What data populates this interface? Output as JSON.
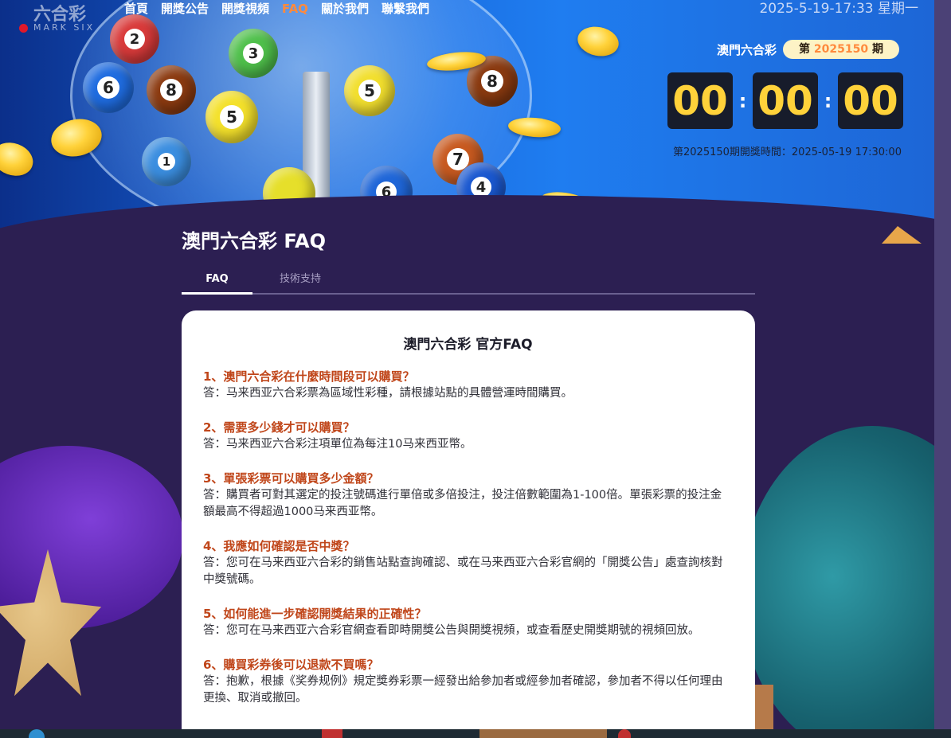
{
  "logo": {
    "main": "六合彩",
    "sub": "MARK SIX"
  },
  "nav": [
    {
      "label": "首頁"
    },
    {
      "label": "開獎公告"
    },
    {
      "label": "開獎視頻"
    },
    {
      "label": "FAQ"
    },
    {
      "label": "關於我們"
    },
    {
      "label": "聯繫我們"
    }
  ],
  "header": {
    "datetime": "2025-5-19-17:33 星期一",
    "lottery_name": "澳門六合彩",
    "draw_prefix": "第",
    "draw_number": "2025150",
    "draw_suffix": "期",
    "countdown": {
      "hours": "00",
      "minutes": "00",
      "seconds": "00",
      "separator": ":"
    },
    "draw_time": "第2025150期開獎時間：2025-05-19 17:30:00"
  },
  "balls": [
    "2",
    "3",
    "6",
    "8",
    "5",
    "5",
    "8",
    "7",
    "4",
    "1",
    "6"
  ],
  "page": {
    "title": "澳門六合彩 FAQ",
    "tabs": [
      {
        "label": "FAQ"
      },
      {
        "label": "技術支持"
      }
    ]
  },
  "faq": {
    "title": "澳門六合彩 官方FAQ",
    "items": [
      {
        "q": "1、澳門六合彩在什麼時間段可以購買？",
        "a": "答：马来西亚六合彩票為區域性彩種，請根據站點的具體營運時間購買。"
      },
      {
        "q": "2、需要多少錢才可以購買？",
        "a": "答：马来西亚六合彩注項單位為每注10马来西亚幣。"
      },
      {
        "q": "3、單張彩票可以購買多少金額？",
        "a": "答：購買者可對其選定的投注號碼進行單倍或多倍投注，投注倍數範圍為1-100倍。單張彩票的投注金額最高不得超過1000马来西亚幣。"
      },
      {
        "q": "4、我應如何確認是否中獎？",
        "a": "答：您可在马来西亚六合彩的銷售站點查詢確認、或在马来西亚六合彩官網的「開獎公告」處查詢核對中獎號碼。"
      },
      {
        "q": "5、如何能進一步確認開獎結果的正確性？",
        "a": "答：您可在马来西亚六合彩官網查看即時開獎公告與開獎視頻，或查看歷史開獎期號的視頻回放。"
      },
      {
        "q": "6、購買彩券後可以退款不買嗎？",
        "a": "答：抱歉，根據《奖券规例》規定獎券彩票一經發出給參加者或經參加者確認，參加者不得以任何理由更換、取消或撤回。"
      }
    ]
  }
}
